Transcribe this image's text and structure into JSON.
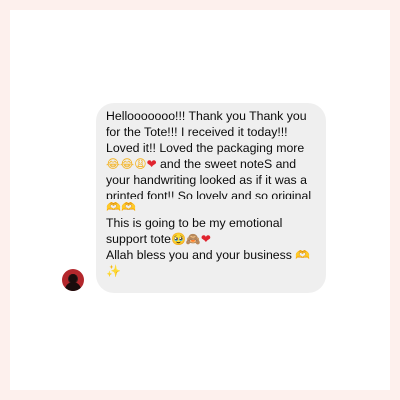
{
  "message": {
    "line1": "Hellooooooo!!! Thank you Thank you",
    "line2": "for the Tote!!! I received it today!!!",
    "line3": "Loved it!! Loved the packaging more",
    "line4_text": " and the sweet noteS and",
    "line5": "your handwriting looked as if it was a",
    "line6": "printed font!! So lovely and so original",
    "line8": "This is going to be my emotional",
    "line9_text": "support tote",
    "line10_text": "Allah bless you and your business ",
    "emojis": {
      "laugh": "😂",
      "weary": "😩",
      "heart": "❤",
      "hands": "🫶",
      "holding_tears": "🥹",
      "monkey": "🙈",
      "sparkles": "✨"
    }
  },
  "colors": {
    "page_background": "#fdf0ed",
    "card_background": "#ffffff",
    "bubble_background": "#efefef",
    "text": "#0b0b0b"
  }
}
